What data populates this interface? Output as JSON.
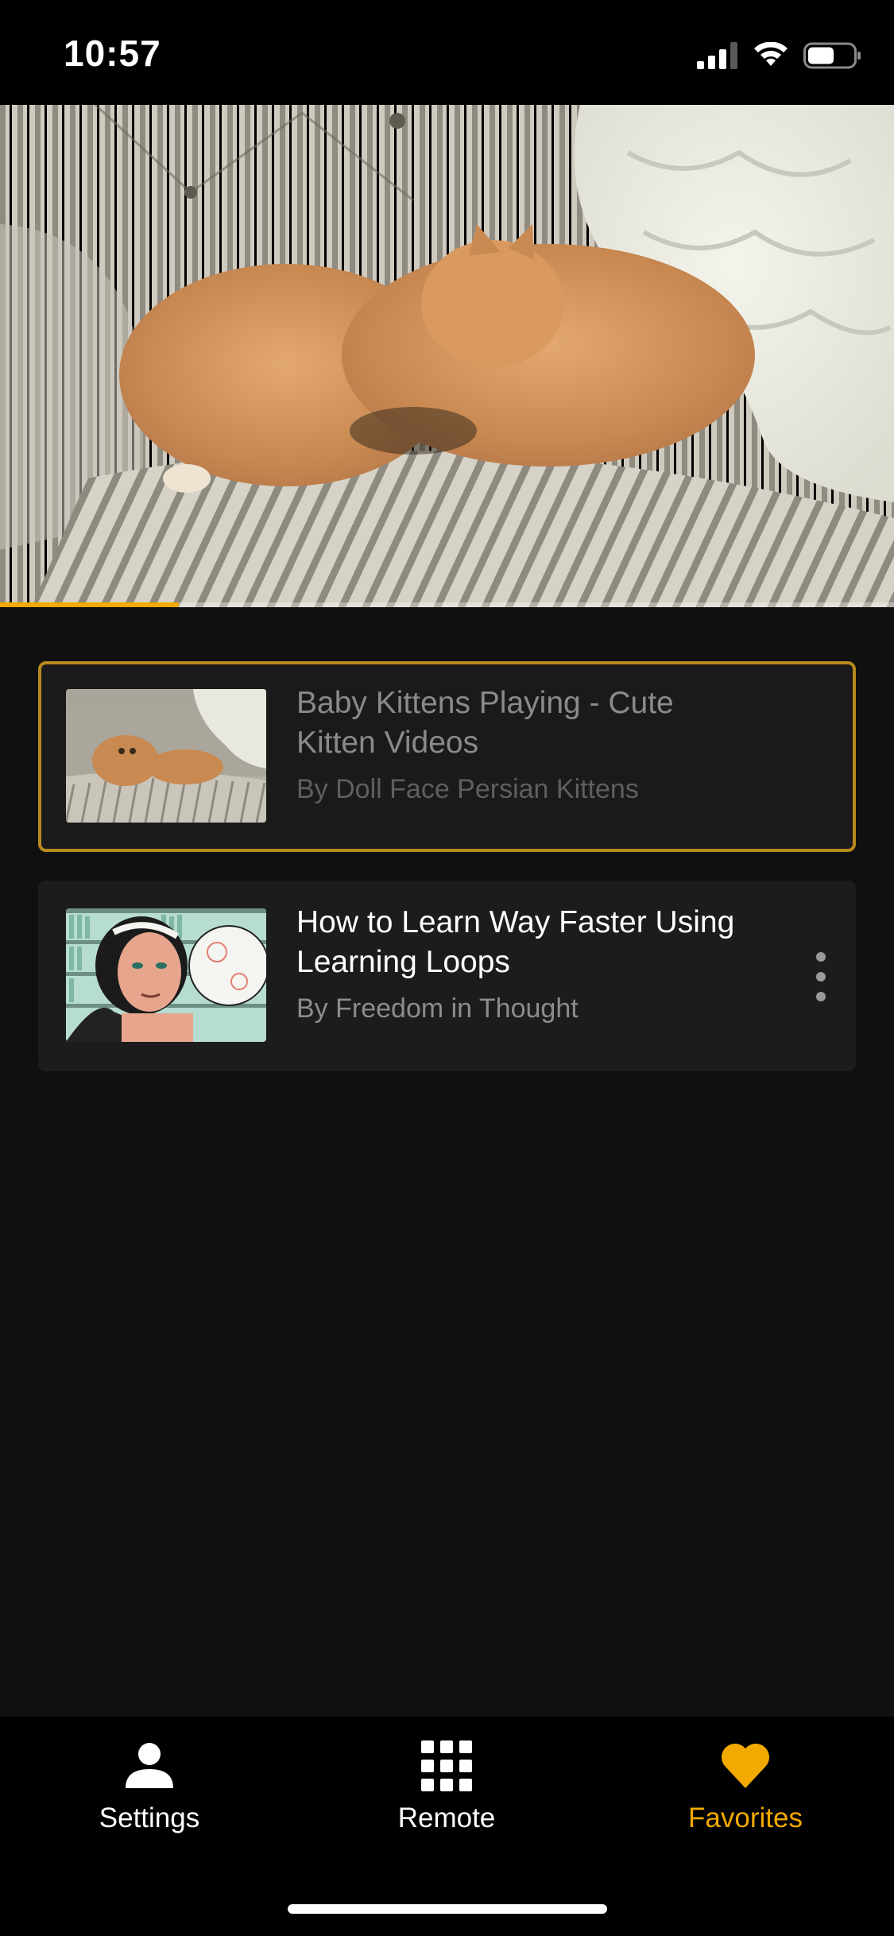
{
  "status_bar": {
    "time": "10:57",
    "icons": [
      "cellular-signal-icon",
      "wifi-icon",
      "battery-icon"
    ]
  },
  "player": {
    "progress_fraction": 0.2,
    "progress_color": "#f2a900"
  },
  "videos": [
    {
      "title": "Baby Kittens Playing - Cute Kitten Videos",
      "author": "By Doll Face Persian Kittens",
      "now_playing": true
    },
    {
      "title": "How to Learn Way Faster Using Learning Loops",
      "author": "By Freedom in Thought",
      "now_playing": false
    }
  ],
  "tabs": [
    {
      "label": "Settings",
      "icon": "person-icon",
      "selected": false
    },
    {
      "label": "Remote",
      "icon": "grid-icon",
      "selected": false
    },
    {
      "label": "Favorites",
      "icon": "heart-icon",
      "selected": true
    }
  ],
  "colors": {
    "accent": "#f2a900",
    "background": "#101010",
    "active_border": "#b88a1d"
  }
}
